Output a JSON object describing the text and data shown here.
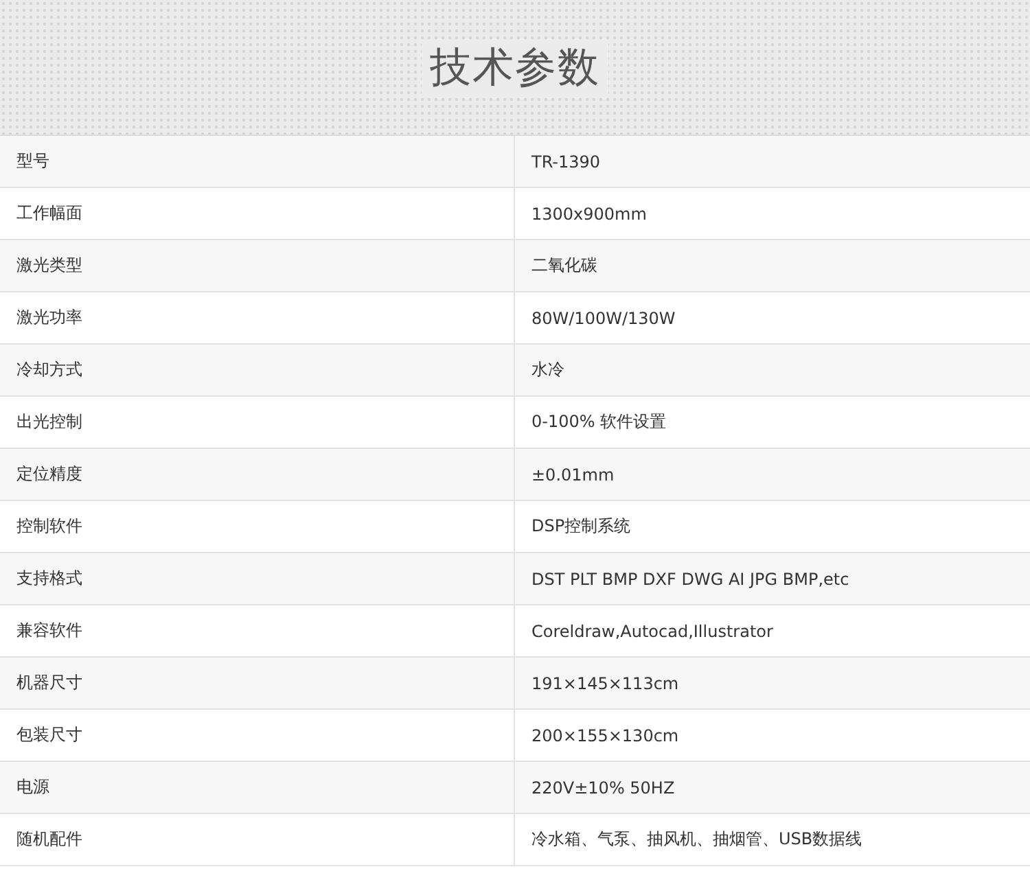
{
  "title": "技术参数",
  "rows": [
    {
      "label": "型号",
      "value": "TR-1390"
    },
    {
      "label": "工作幅面",
      "value": "1300x900mm"
    },
    {
      "label": "激光类型",
      "value": "二氧化碳"
    },
    {
      "label": "激光功率",
      "value": "80W/100W/130W"
    },
    {
      "label": "冷却方式",
      "value": "水冷"
    },
    {
      "label": "出光控制",
      "value": "0-100% 软件设置"
    },
    {
      "label": "定位精度",
      "value": "±0.01mm"
    },
    {
      "label": "控制软件",
      "value": "DSP控制系统"
    },
    {
      "label": "支持格式",
      "value": "DST PLT BMP DXF DWG AI JPG BMP,etc"
    },
    {
      "label": "兼容软件",
      "value": "Coreldraw,Autocad,Illustrator"
    },
    {
      "label": "机器尺寸",
      "value": "191×145×113cm"
    },
    {
      "label": "包装尺寸",
      "value": "200×155×130cm"
    },
    {
      "label": "电源",
      "value": "220V±10% 50HZ"
    },
    {
      "label": "随机配件",
      "value": "冷水箱、气泵、抽风机、抽烟管、USB数据线"
    }
  ]
}
